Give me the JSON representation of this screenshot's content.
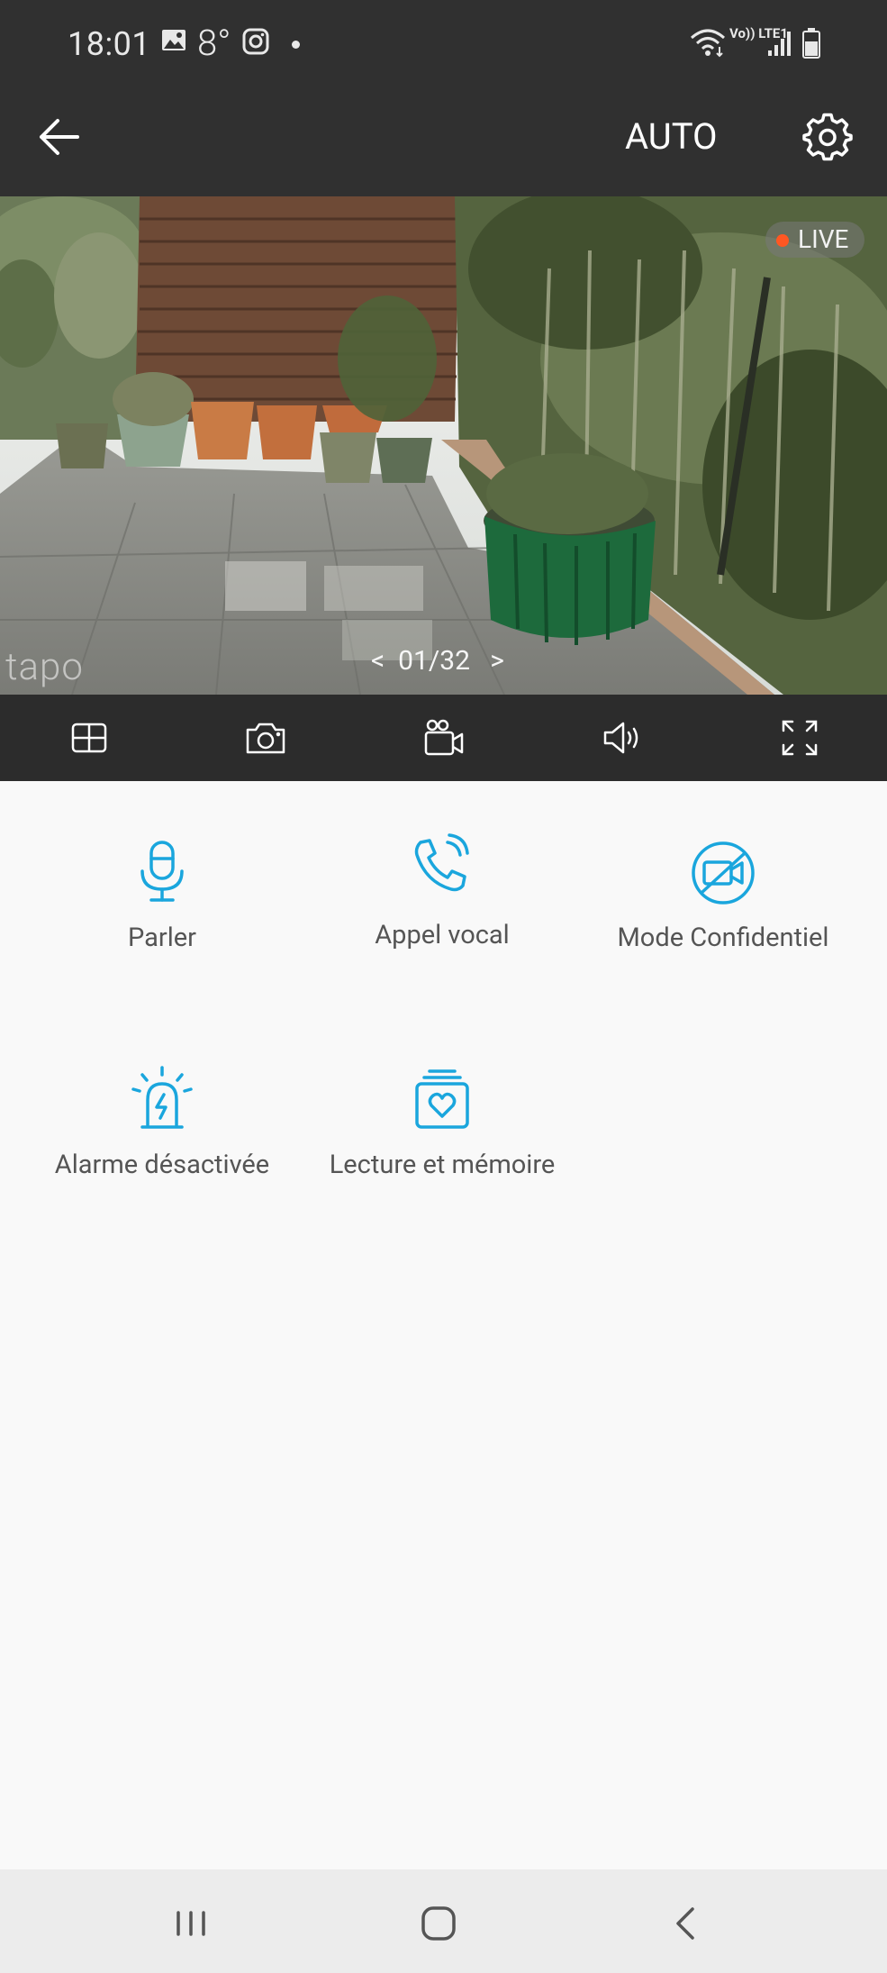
{
  "status_bar": {
    "time": "18:01",
    "temperature": "8°",
    "network_label": "Vo)) LTE1"
  },
  "app_bar": {
    "mode_label": "AUTO"
  },
  "camera": {
    "live_label": "LIVE",
    "watermark": "tapo",
    "pager_prev": "<",
    "pager_text": "01/32",
    "pager_next": ">"
  },
  "toolbar": {
    "items": [
      "grid-view-icon",
      "camera-snapshot-icon",
      "record-video-icon",
      "speaker-volume-icon",
      "fullscreen-icon"
    ]
  },
  "features": {
    "items": [
      {
        "label": "Parler",
        "icon": "microphone-icon"
      },
      {
        "label": "Appel vocal",
        "icon": "phone-call-icon"
      },
      {
        "label": "Mode Confidentiel",
        "icon": "privacy-camera-off-icon"
      },
      {
        "label": "Alarme désactivée",
        "icon": "alarm-siren-icon"
      },
      {
        "label": "Lecture et mémoire",
        "icon": "playback-memory-icon"
      }
    ]
  },
  "colors": {
    "accent": "#1aa6dd",
    "bar_bg": "#303030",
    "toolbar_bg": "#2c2c2c",
    "page_bg": "#f9f9f9",
    "live_dot": "#ff5722"
  }
}
